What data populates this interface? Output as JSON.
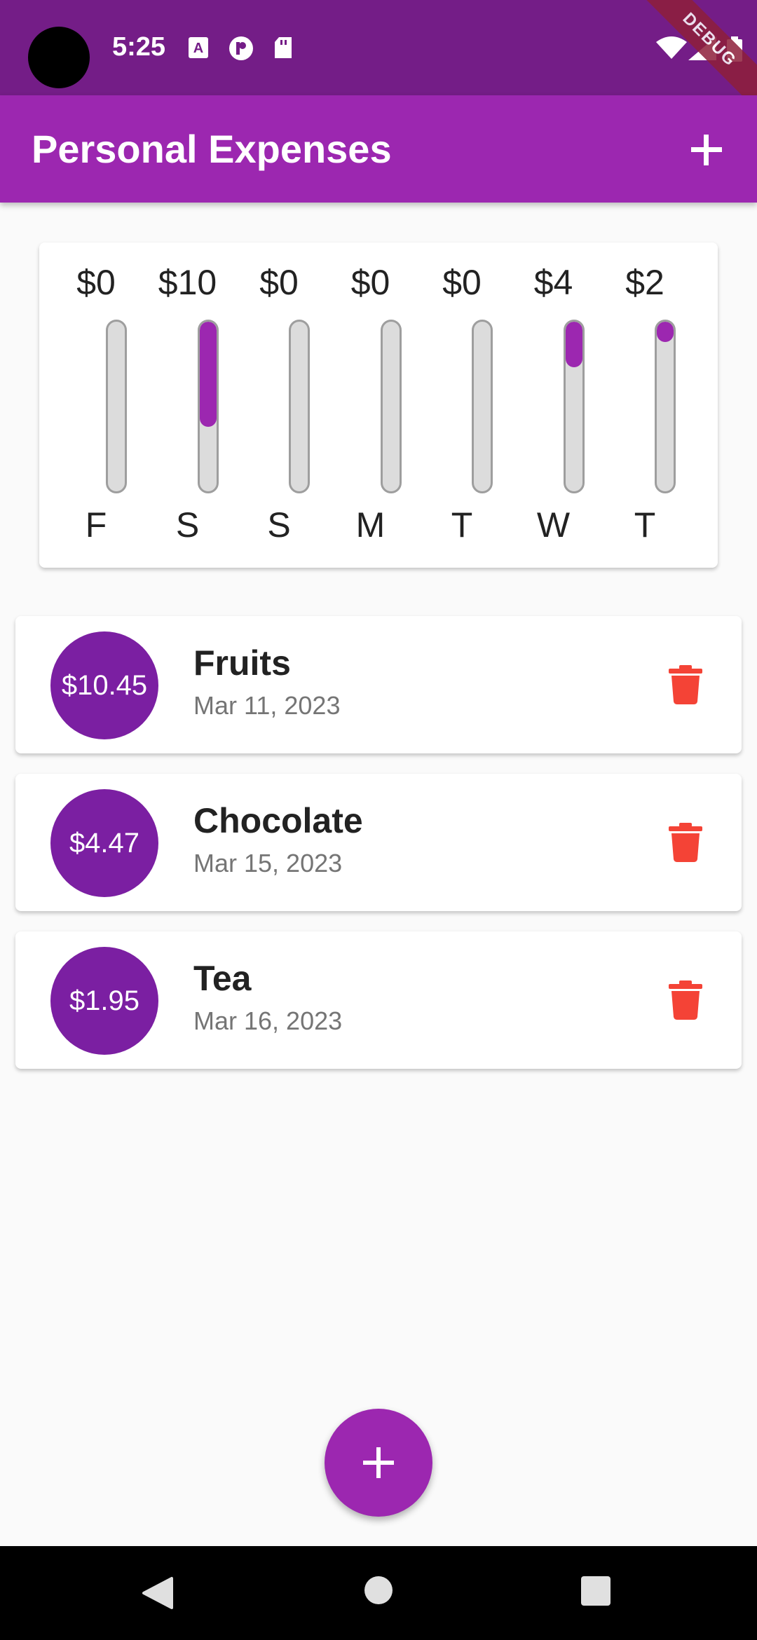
{
  "status_bar": {
    "time": "5:25",
    "icons": [
      "a-notification-icon",
      "p-notification-icon",
      "sd-card-icon",
      "wifi-icon",
      "signal-icon",
      "battery-icon"
    ],
    "debug_label": "DEBUG",
    "background": "#741d87"
  },
  "app_bar": {
    "title": "Personal Expenses",
    "add_icon": "plus-icon",
    "background": "#9c27b0"
  },
  "chart": {
    "accent": "#9c27b0",
    "bars": [
      {
        "day": "F",
        "amount": "$0",
        "fraction": 0.0
      },
      {
        "day": "S",
        "amount": "$10",
        "fraction": 0.62
      },
      {
        "day": "S",
        "amount": "$0",
        "fraction": 0.0
      },
      {
        "day": "M",
        "amount": "$0",
        "fraction": 0.0
      },
      {
        "day": "T",
        "amount": "$0",
        "fraction": 0.0
      },
      {
        "day": "W",
        "amount": "$4",
        "fraction": 0.27
      },
      {
        "day": "T",
        "amount": "$2",
        "fraction": 0.12
      }
    ]
  },
  "transactions": [
    {
      "amount": "$10.45",
      "title": "Fruits",
      "date": "Mar 11, 2023"
    },
    {
      "amount": "$4.47",
      "title": "Chocolate",
      "date": "Mar 15, 2023"
    },
    {
      "amount": "$1.95",
      "title": "Tea",
      "date": "Mar 16, 2023"
    }
  ],
  "delete_icon": "trash-icon",
  "delete_color": "#f44336",
  "fab_icon": "plus-icon",
  "nav_bar": {
    "icons": [
      "back-icon",
      "home-icon",
      "recents-icon"
    ]
  }
}
